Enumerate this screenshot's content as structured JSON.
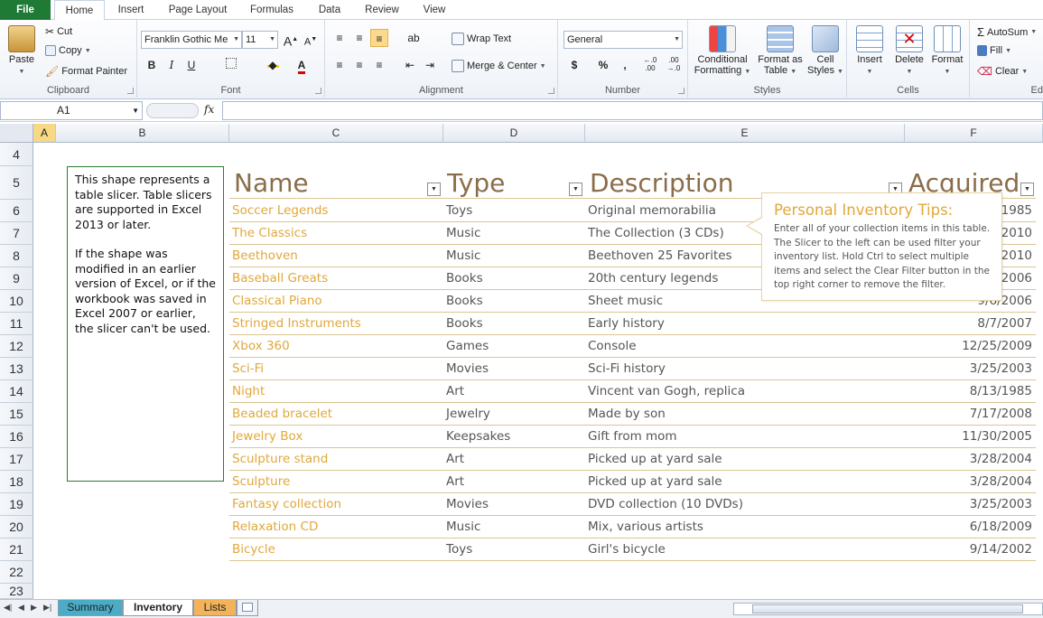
{
  "tabs": [
    "File",
    "Home",
    "Insert",
    "Page Layout",
    "Formulas",
    "Data",
    "Review",
    "View"
  ],
  "ribbon": {
    "clipboard": {
      "label": "Clipboard",
      "paste": "Paste",
      "cut": "Cut",
      "copy": "Copy",
      "format_painter": "Format Painter"
    },
    "font": {
      "label": "Font",
      "family": "Franklin Gothic Me",
      "size": "11",
      "bold": "B",
      "italic": "I",
      "underline": "U",
      "grow": "A",
      "shrink": "A"
    },
    "alignment": {
      "label": "Alignment",
      "wrap": "Wrap Text",
      "merge": "Merge & Center"
    },
    "number": {
      "label": "Number",
      "format": "General",
      "currency": "$",
      "percent": "%",
      "comma": ",",
      "inc_decimal": "←.0 .00",
      "dec_decimal": ".00 →.0"
    },
    "styles": {
      "label": "Styles",
      "conditional": "Conditional Formatting",
      "format_table": "Format as Table",
      "cell_styles": "Cell Styles"
    },
    "cells": {
      "label": "Cells",
      "insert": "Insert",
      "delete": "Delete",
      "format": "Format"
    },
    "editing": {
      "label": "Ed",
      "autosum": "AutoSum",
      "fill": "Fill",
      "clear": "Clear"
    }
  },
  "formula_bar": {
    "name_box": "A1",
    "fx": "fx",
    "formula": ""
  },
  "columns": [
    "A",
    "B",
    "C",
    "D",
    "E",
    "F"
  ],
  "rows": [
    "4",
    "5",
    "6",
    "7",
    "8",
    "9",
    "10",
    "11",
    "12",
    "13",
    "14",
    "15",
    "16",
    "17",
    "18",
    "19",
    "20",
    "21",
    "22",
    "23"
  ],
  "table": {
    "headers": [
      "Name",
      "Type",
      "Description",
      "Acquired"
    ],
    "rows": [
      [
        "Soccer Legends",
        "Toys",
        "Original memorabilia",
        "1985"
      ],
      [
        "The Classics",
        "Music",
        "The Collection (3 CDs)",
        "2010"
      ],
      [
        "Beethoven",
        "Music",
        "Beethoven 25 Favorites",
        "2010"
      ],
      [
        "Baseball Greats",
        "Books",
        "20th century legends",
        "2006"
      ],
      [
        "Classical Piano",
        "Books",
        "Sheet music",
        "9/6/2006"
      ],
      [
        "Stringed Instruments",
        "Books",
        "Early history",
        "8/7/2007"
      ],
      [
        "Xbox 360",
        "Games",
        "Console",
        "12/25/2009"
      ],
      [
        "Sci-Fi",
        "Movies",
        "Sci-Fi history",
        "3/25/2003"
      ],
      [
        "Night",
        "Art",
        "Vincent van Gogh, replica",
        "8/13/1985"
      ],
      [
        "Beaded bracelet",
        "Jewelry",
        "Made by son",
        "7/17/2008"
      ],
      [
        "Jewelry Box",
        "Keepsakes",
        "Gift from mom",
        "11/30/2005"
      ],
      [
        "Sculpture stand",
        "Art",
        "Picked up at yard sale",
        "3/28/2004"
      ],
      [
        "Sculpture",
        "Art",
        "Picked up at yard sale",
        "3/28/2004"
      ],
      [
        "Fantasy collection",
        "Movies",
        "DVD collection (10 DVDs)",
        "3/25/2003"
      ],
      [
        "Relaxation CD",
        "Music",
        "Mix, various artists",
        "6/18/2009"
      ],
      [
        "Bicycle",
        "Toys",
        "Girl's bicycle",
        "9/14/2002"
      ]
    ]
  },
  "shape": {
    "para1": "This shape represents a table slicer. Table slicers are supported in Excel 2013 or later.",
    "para2": "If the shape was modified in an earlier version of Excel, or if the workbook was saved in Excel 2007 or earlier, the slicer can't be used."
  },
  "tips": {
    "title": "Personal Inventory Tips:",
    "body": "Enter all of your collection items in this table. The Slicer to the left can be used filter your inventory list. Hold Ctrl to select multiple items and select the Clear Filter button in the top right corner to remove the filter."
  },
  "sheets": [
    "Summary",
    "Inventory",
    "Lists"
  ],
  "colors": {
    "file_tab": "#1f7a36",
    "header_text": "#8a6d4a",
    "name_text": "#e0a83b",
    "summary_tab": "#4bacc6",
    "lists_tab": "#f2b35b"
  }
}
